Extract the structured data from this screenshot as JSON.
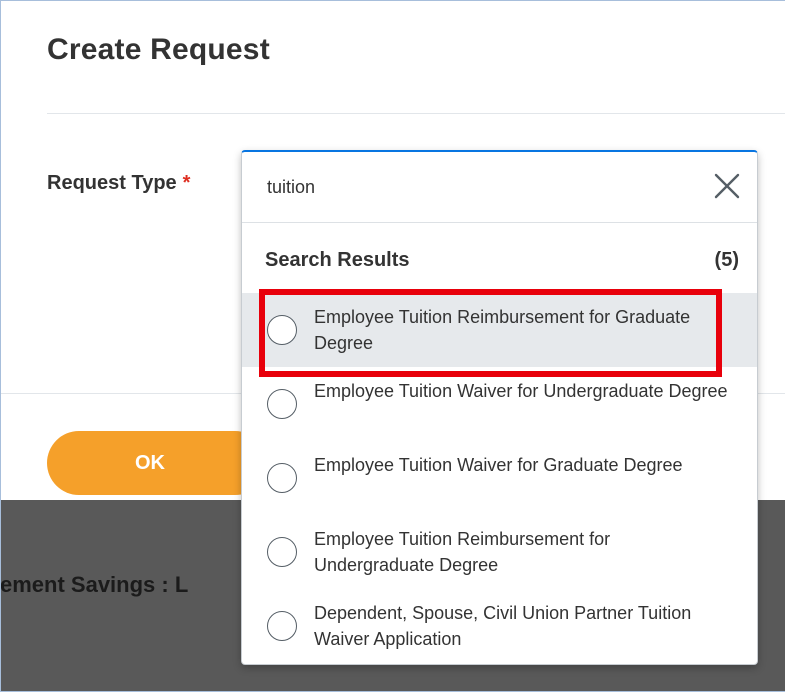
{
  "modal": {
    "title": "Create Request",
    "field_label": "Request Type",
    "required_marker": "*",
    "ok_label": "OK"
  },
  "background": {
    "partial_text": "ement Savings : L"
  },
  "search": {
    "value": "tuition",
    "clear_icon": "close-icon"
  },
  "results": {
    "title": "Search Results",
    "count": "(5)",
    "items": [
      {
        "label": "Employee Tuition Reimbursement for Graduate Degree",
        "highlighted": true
      },
      {
        "label": "Employee Tuition Waiver for Undergraduate Degree",
        "highlighted": false
      },
      {
        "label": "Employee Tuition Waiver for Graduate Degree",
        "highlighted": false
      },
      {
        "label": "Employee Tuition Reimbursement for Undergraduate Degree",
        "highlighted": false
      },
      {
        "label": "Dependent, Spouse, Civil Union Partner Tuition Waiver Application",
        "highlighted": false
      }
    ]
  },
  "colors": {
    "accent_blue": "#0875e1",
    "ok_orange": "#f5a02a",
    "required_red": "#de2e21",
    "highlight_red": "#e8000b",
    "overlay_gray": "#595959"
  }
}
